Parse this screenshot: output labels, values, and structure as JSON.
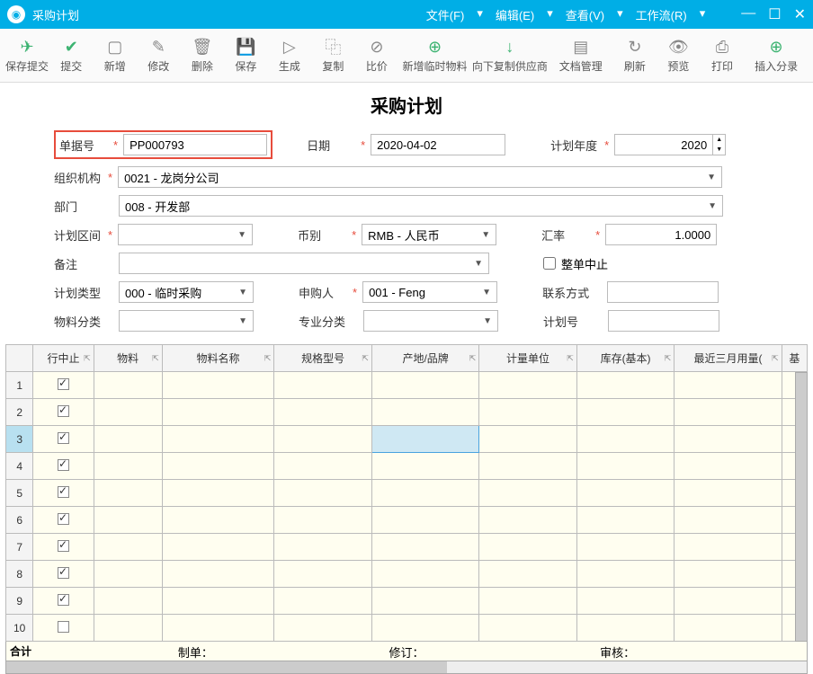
{
  "title": "采购计划",
  "menus": {
    "file": "文件(F)",
    "edit": "编辑(E)",
    "view": "查看(V)",
    "workflow": "工作流(R)"
  },
  "toolbar": {
    "save_submit": "保存提交",
    "submit": "提交",
    "new": "新增",
    "modify": "修改",
    "delete": "删除",
    "save": "保存",
    "generate": "生成",
    "copy": "复制",
    "compare": "比价",
    "add_temp_material": "新增临时物料",
    "copy_supplier_down": "向下复制供应商",
    "doc_manage": "文档管理",
    "refresh": "刷新",
    "preview": "预览",
    "print": "打印",
    "insert_entry": "插入分录"
  },
  "form": {
    "title": "采购计划",
    "doc_no_label": "单据号",
    "doc_no": "PP000793",
    "date_label": "日期",
    "date": "2020-04-02",
    "plan_year_label": "计划年度",
    "plan_year": "2020",
    "org_label": "组织机构",
    "org": "0021 - 龙岗分公司",
    "dept_label": "部门",
    "dept": "008 - 开发部",
    "plan_interval_label": "计划区间",
    "plan_interval": "",
    "currency_label": "币别",
    "currency": "RMB - 人民币",
    "rate_label": "汇率",
    "rate": "1.0000",
    "remark_label": "备注",
    "remark": "",
    "whole_cancel_label": "整单中止",
    "plan_type_label": "计划类型",
    "plan_type": "000 - 临时采购",
    "applicant_label": "申购人",
    "applicant": "001 - Feng",
    "contact_label": "联系方式",
    "contact": "",
    "material_class_label": "物料分类",
    "material_class": "",
    "pro_class_label": "专业分类",
    "pro_class": "",
    "plan_no_label": "计划号",
    "plan_no": ""
  },
  "grid": {
    "headers": {
      "row_cancel": "行中止",
      "material": "物料",
      "material_name": "物料名称",
      "spec": "规格型号",
      "origin": "产地/品牌",
      "unit": "计量单位",
      "stock": "库存(基本)",
      "recent_usage": "最近三月用量(",
      "last": "基"
    },
    "total_label": "合计"
  },
  "footer": {
    "maker": "制单：",
    "reviser": "修订：",
    "auditor": "审核："
  }
}
